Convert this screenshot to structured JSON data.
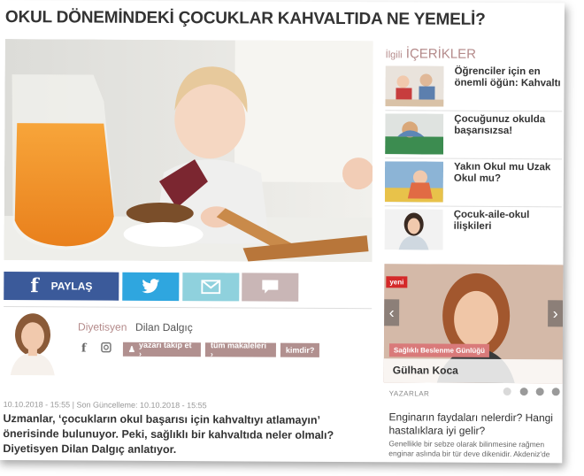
{
  "article": {
    "title": "OKUL DÖNEMİNDEKİ ÇOCUKLAR KAHVALTIDA NE YEMELİ?",
    "date_line": "10.10.2018 - 15:55 | Son Güncelleme: 10.10.2018 - 15:55",
    "lead": "Uzmanlar, ‘çocukların okul başarısı için kahvaltıyı atlamayın’ önerisinde bulunuyor. Peki, sağlıklı bir kahvaltıda neler olmalı? Diyetisyen Dilan Dalgıç anlatıyor."
  },
  "share": {
    "facebook_label": "PAYLAŞ",
    "facebook_glyph": "f",
    "twitter_icon": "twitter-bird-icon",
    "mail_icon": "envelope-icon",
    "comment_icon": "speech-bubble-icon"
  },
  "author": {
    "role": "Diyetisyen",
    "name": "Dilan Dalgıç",
    "follow_label": "yazarı takip et ›",
    "articles_label": "tüm makaleleri ›",
    "who_label": "kimdir?"
  },
  "related": {
    "heading_small": "İlgili",
    "heading_big": "İÇERİKLER",
    "items": [
      {
        "label": "Öğrenciler için en önemli öğün: Kahvaltı"
      },
      {
        "label": "Çocuğunuz okulda başarısızsa!"
      },
      {
        "label": "Yakın Okul mu Uzak Okul mu?"
      },
      {
        "label": "Çocuk-aile-okul ilişkileri"
      }
    ]
  },
  "promo": {
    "badge": "yeni",
    "blog_tag": "Sağlıklı Beslenme Günlüğü",
    "name": "Gülhan Koca",
    "prev": "‹",
    "next": "›",
    "section_label": "YAZARLAR"
  },
  "feature": {
    "title": "Enginarın faydaları nelerdir? Hangi hastalıklara iyi gelir?",
    "text": "Genellikle bir sebze olarak bilinmesine rağmen enginar aslında bir tür deve dikenidir. Akdeniz'de"
  },
  "colors": {
    "facebook": "#3b5a9a",
    "twitter": "#2fa6df",
    "mail": "#8fd1dd",
    "comment": "#c9b6b6",
    "accent": "#b1908f"
  }
}
